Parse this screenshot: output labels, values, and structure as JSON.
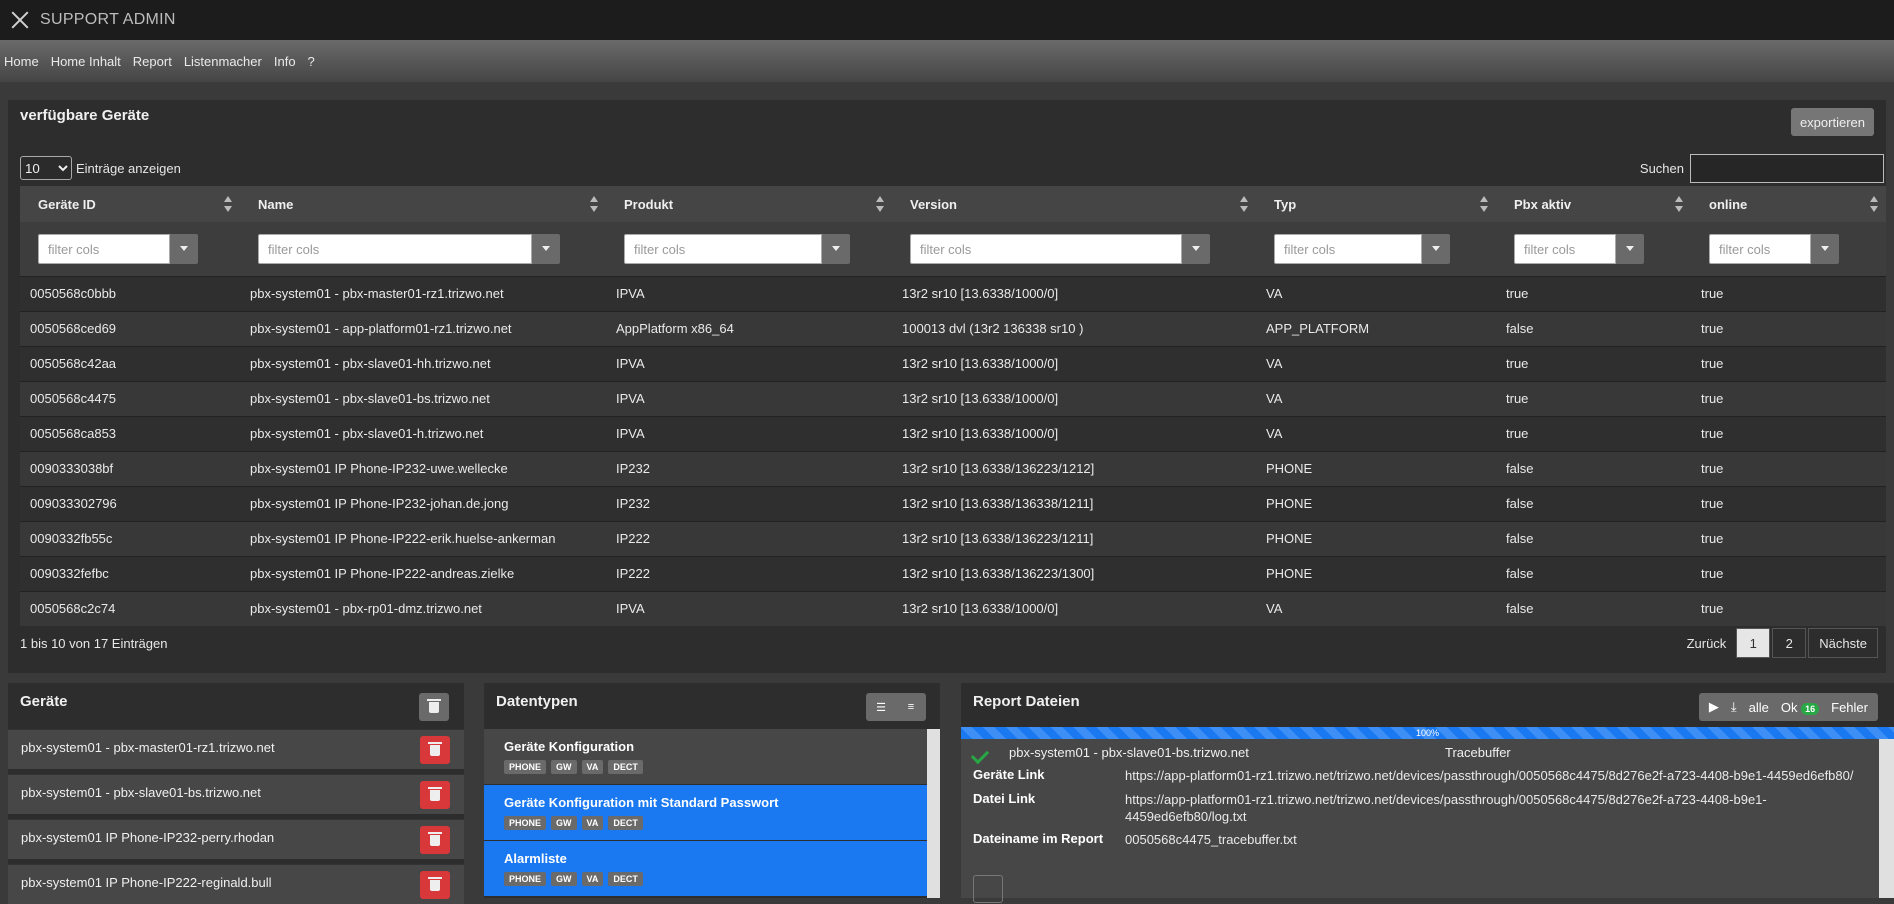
{
  "app": {
    "title": "SUPPORT ADMIN"
  },
  "nav": [
    "Home",
    "Home Inhalt",
    "Report",
    "Listenmacher",
    "Info",
    "?"
  ],
  "devices_table": {
    "title": "verfügbare Geräte",
    "export_label": "exportieren",
    "page_size": "10",
    "entries_label": "Einträge anzeigen",
    "search_label": "Suchen",
    "filter_placeholder": "filter cols",
    "columns": [
      "Geräte ID",
      "Name",
      "Produkt",
      "Version",
      "Typ",
      "Pbx aktiv",
      "online"
    ],
    "rows": [
      [
        "0050568c0bbb",
        "pbx-system01 - pbx-master01-rz1.trizwo.net",
        "IPVA",
        "13r2 sr10 [13.6338/1000/0]",
        "VA",
        "true",
        "true"
      ],
      [
        "0050568ced69",
        "pbx-system01 - app-platform01-rz1.trizwo.net",
        "AppPlatform x86_64",
        "100013 dvl (13r2 136338 sr10 )",
        "APP_PLATFORM",
        "false",
        "true"
      ],
      [
        "0050568c42aa",
        "pbx-system01 - pbx-slave01-hh.trizwo.net",
        "IPVA",
        "13r2 sr10 [13.6338/1000/0]",
        "VA",
        "true",
        "true"
      ],
      [
        "0050568c4475",
        "pbx-system01 - pbx-slave01-bs.trizwo.net",
        "IPVA",
        "13r2 sr10 [13.6338/1000/0]",
        "VA",
        "true",
        "true"
      ],
      [
        "0050568ca853",
        "pbx-system01 - pbx-slave01-h.trizwo.net",
        "IPVA",
        "13r2 sr10 [13.6338/1000/0]",
        "VA",
        "true",
        "true"
      ],
      [
        "0090333038bf",
        "pbx-system01 IP Phone-IP232-uwe.wellecke",
        "IP232",
        "13r2 sr10 [13.6338/136223/1212]",
        "PHONE",
        "false",
        "true"
      ],
      [
        "009033302796",
        "pbx-system01 IP Phone-IP232-johan.de.jong",
        "IP232",
        "13r2 sr10 [13.6338/136338/1211]",
        "PHONE",
        "false",
        "true"
      ],
      [
        "0090332fb55c",
        "pbx-system01 IP Phone-IP222-erik.huelse-ankerman",
        "IP222",
        "13r2 sr10 [13.6338/136223/1211]",
        "PHONE",
        "false",
        "true"
      ],
      [
        "0090332fefbc",
        "pbx-system01 IP Phone-IP222-andreas.zielke",
        "IP222",
        "13r2 sr10 [13.6338/136223/1300]",
        "PHONE",
        "false",
        "true"
      ],
      [
        "0050568c2c74",
        "pbx-system01 - pbx-rp01-dmz.trizwo.net",
        "IPVA",
        "13r2 sr10 [13.6338/1000/0]",
        "VA",
        "false",
        "true"
      ]
    ],
    "info": "1 bis 10 von 17 Einträgen",
    "pager": {
      "prev": "Zurück",
      "pages": [
        "1",
        "2"
      ],
      "next": "Nächste"
    }
  },
  "geraete": {
    "title": "Geräte",
    "items": [
      "pbx-system01 - pbx-master01-rz1.trizwo.net",
      "pbx-system01 - pbx-slave01-bs.trizwo.net",
      "pbx-system01 IP Phone-IP232-perry.rhodan",
      "pbx-system01 IP Phone-IP222-reginald.bull"
    ]
  },
  "datentypen": {
    "title": "Datentypen",
    "items": [
      {
        "name": "Geräte Konfiguration",
        "tags": [
          "PHONE",
          "GW",
          "VA",
          "DECT"
        ],
        "selected": false
      },
      {
        "name": "Geräte Konfiguration mit Standard Passwort",
        "tags": [
          "PHONE",
          "GW",
          "VA",
          "DECT"
        ],
        "selected": true
      },
      {
        "name": "Alarmliste",
        "tags": [
          "PHONE",
          "GW",
          "VA",
          "DECT"
        ],
        "selected": true
      }
    ]
  },
  "report": {
    "title": "Report Dateien",
    "toolbar": {
      "all": "alle",
      "ok": "Ok",
      "ok_count": "16",
      "error": "Fehler"
    },
    "progress": "100%",
    "device": "pbx-system01 - pbx-slave01-bs.trizwo.net",
    "type": "Tracebuffer",
    "device_link_label": "Geräte Link",
    "device_link": "https://app-platform01-rz1.trizwo.net/trizwo.net/devices/passthrough/0050568c4475/8d276e2f-a723-4408-b9e1-4459ed6efb80/",
    "file_link_label": "Datei Link",
    "file_link": "https://app-platform01-rz1.trizwo.net/trizwo.net/devices/passthrough/0050568c4475/8d276e2f-a723-4408-b9e1-4459ed6efb80/log.txt",
    "filename_label": "Dateiname im Report",
    "filename": "0050568c4475_tracebuffer.txt"
  }
}
